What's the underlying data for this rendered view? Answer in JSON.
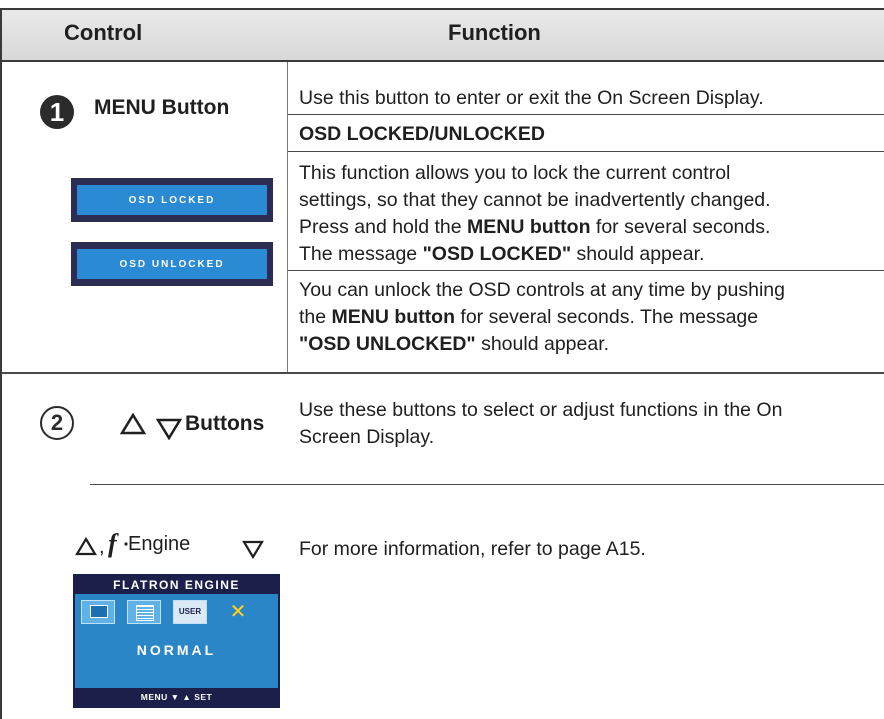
{
  "header": {
    "control": "Control",
    "function": "Function"
  },
  "row1": {
    "number": "1",
    "label": "MENU Button",
    "desc": "Use this button to enter or exit the On Screen Display.",
    "osd_heading": "OSD LOCKED/UNLOCKED",
    "para1": {
      "t1": "This function allows you to lock the current control",
      "t2": "settings, so that they cannot be inadvertently changed.",
      "t3a": "Press and hold the ",
      "t3b": "MENU button",
      "t3c": " for several seconds.",
      "t4a": "The message ",
      "t4b": "\"OSD LOCKED\"",
      "t4c": " should appear."
    },
    "para2": {
      "t1": "You can unlock the OSD controls at any time by pushing",
      "t2a": "the ",
      "t2b": "MENU button",
      "t2c": " for several seconds. The message",
      "t3a": "\"OSD UNLOCKED\"",
      "t3b": " should appear."
    },
    "osd_locked": "OSD LOCKED",
    "osd_unlocked": "OSD UNLOCKED"
  },
  "row2": {
    "number": "2",
    "label": "Buttons",
    "desc_l1": "Use these buttons to select or adjust functions in the On",
    "desc_l2": "Screen Display.",
    "fengine_label": "Engine",
    "fengine_desc": "For more information, refer to page A15.",
    "screen": {
      "title": "FLATRON  ENGINE",
      "user": "USER",
      "normal": "NORMAL",
      "bottom": "MENU  ▼  ▲  SET"
    }
  }
}
